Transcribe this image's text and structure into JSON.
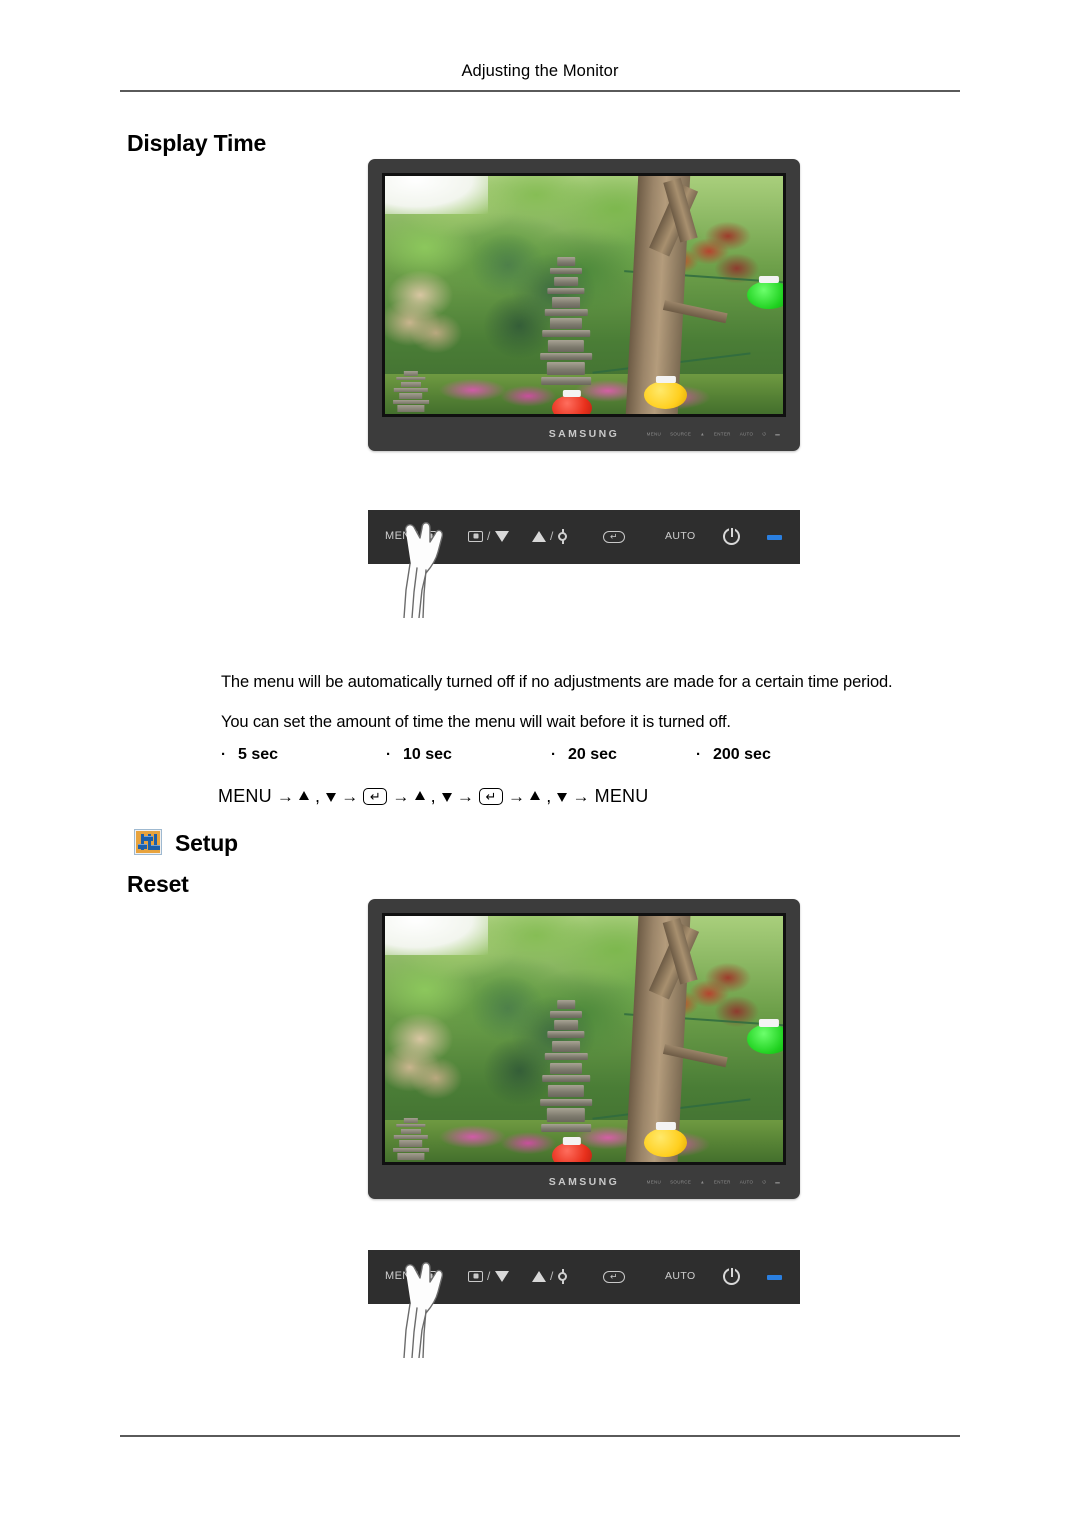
{
  "header": {
    "running_title": "Adjusting the Monitor"
  },
  "sections": {
    "display_time": {
      "title": "Display Time",
      "paragraph_1": "The menu will be automatically turned off if no adjustments are made for a certain time period.",
      "paragraph_2": "You can set the amount of time the menu will wait before it is turned off.",
      "options": [
        {
          "bullet": "·",
          "label": "5 sec"
        },
        {
          "bullet": "·",
          "label": "10 sec"
        },
        {
          "bullet": "·",
          "label": "20 sec"
        },
        {
          "bullet": "·",
          "label": "200 sec"
        }
      ],
      "nav_path": {
        "start": "MENU",
        "end": "MENU",
        "arrow": "→",
        "comma": ","
      }
    },
    "setup": {
      "title": "Setup",
      "icon": "setup-sliders-icon"
    },
    "reset": {
      "title": "Reset"
    }
  },
  "monitor": {
    "brand_logo": "SAMSUNG",
    "bezel_marks": [
      "MENU",
      "SOURCE",
      "▲",
      "ENTER",
      "AUTO",
      "⏻",
      "▬"
    ],
    "screen_content": "korean-temple-garden-photo"
  },
  "control_panel": {
    "buttons": [
      {
        "name": "menu-button",
        "label": "MENU",
        "icon": "menu-icon"
      },
      {
        "name": "source-button",
        "label": "",
        "icon": "source-down-icon",
        "separator": "/"
      },
      {
        "name": "up-button",
        "label": "",
        "icon": "up-brightness-icon",
        "separator": "/"
      },
      {
        "name": "enter-button",
        "label": "",
        "icon": "enter-icon"
      },
      {
        "name": "auto-button",
        "label": "AUTO",
        "icon": "auto-icon"
      },
      {
        "name": "power-button",
        "label": "",
        "icon": "power-icon"
      },
      {
        "name": "led-indicator",
        "label": "",
        "icon": "led-indicator-icon"
      }
    ],
    "hand_pointer": "hand-pressing-menu"
  },
  "colors": {
    "bezel": "#3c3c3c",
    "panel": "#2e2e2e",
    "led_blue": "#2a7fe0",
    "setup_icon_bg": "#e8a33d",
    "setup_icon_slider": "#1d5fa8",
    "rule": "#5a5a5a"
  }
}
